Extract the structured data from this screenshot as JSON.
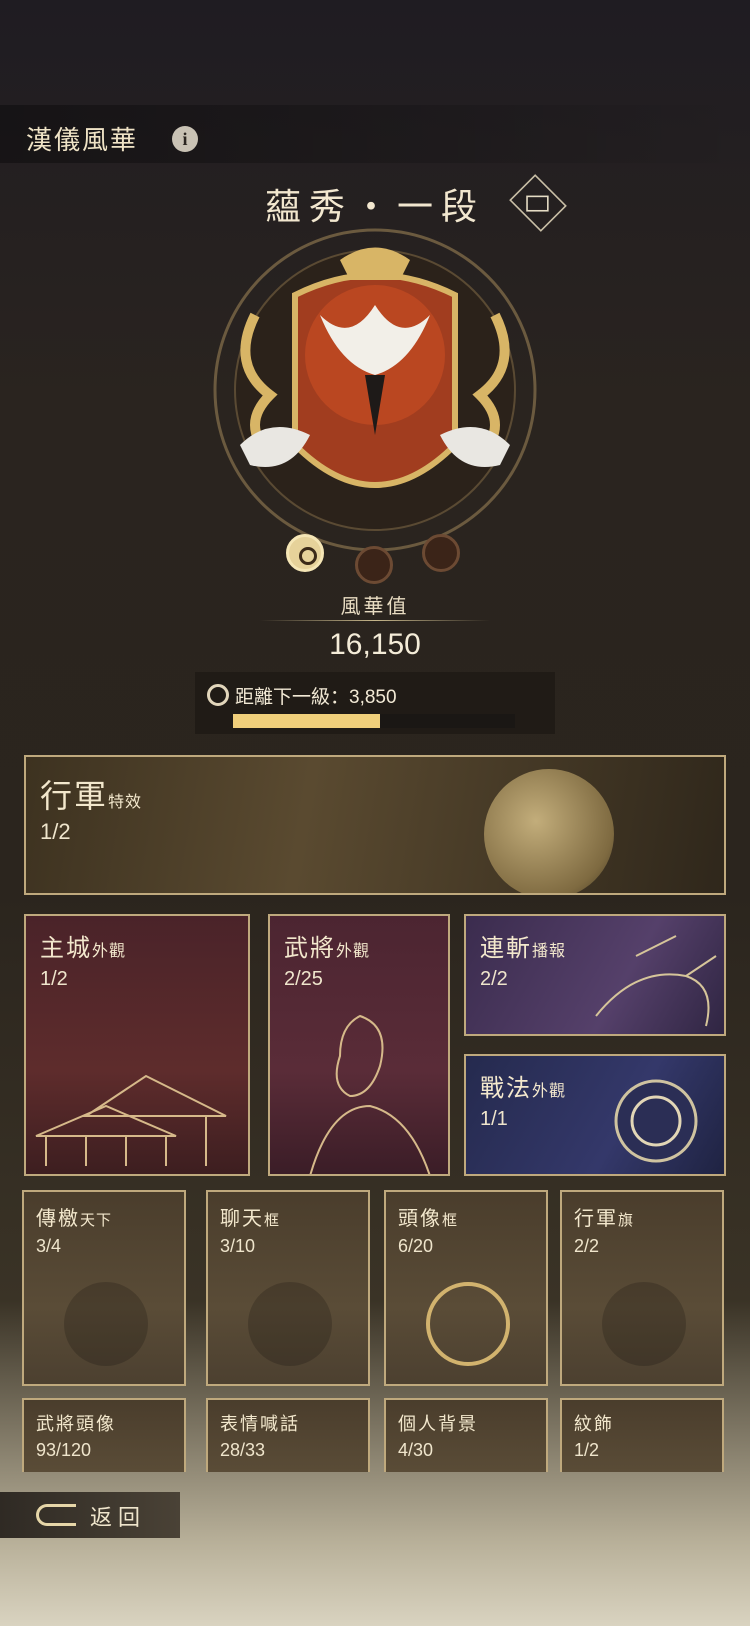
{
  "header": {
    "title": "漢儀風華",
    "info_icon": "info-icon"
  },
  "rank": {
    "title": "蘊秀・一段",
    "chest_icon": "treasure-chest-icon"
  },
  "emblem": {
    "icon": "crane-emblem-icon"
  },
  "stats": {
    "value_label": "風華值",
    "value": "16,150",
    "next_level_text": "距離下一級：3,850",
    "progress_percent": 52
  },
  "cards": {
    "march": {
      "title": "行軍",
      "suffix": "特效",
      "count": "1/2"
    },
    "city": {
      "title": "主城",
      "suffix": "外觀",
      "count": "1/2"
    },
    "general": {
      "title": "武將",
      "suffix": "外觀",
      "count": "2/25"
    },
    "combo": {
      "title": "連斬",
      "suffix": "播報",
      "count": "2/2"
    },
    "tactic": {
      "title": "戰法",
      "suffix": "外觀",
      "count": "1/1"
    }
  },
  "small_cards": [
    {
      "title": "傳檄",
      "suffix": "天下",
      "count": "3/4",
      "icon": "scroll-icon"
    },
    {
      "title": "聊天",
      "suffix": "框",
      "count": "3/10",
      "icon": "chat-frame-icon"
    },
    {
      "title": "頭像",
      "suffix": "框",
      "count": "6/20",
      "icon": "avatar-frame-icon"
    },
    {
      "title": "行軍",
      "suffix": "旗",
      "count": "2/2",
      "icon": "banner-flag-icon"
    }
  ],
  "row_cards": [
    {
      "title": "武將頭像",
      "count": "93/120"
    },
    {
      "title": "表情喊話",
      "count": "28/33"
    },
    {
      "title": "個人背景",
      "count": "4/30"
    },
    {
      "title": "紋飾",
      "count": "1/2"
    }
  ],
  "footer": {
    "back_label": "返回",
    "back_icon": "back-arrow-icon"
  }
}
